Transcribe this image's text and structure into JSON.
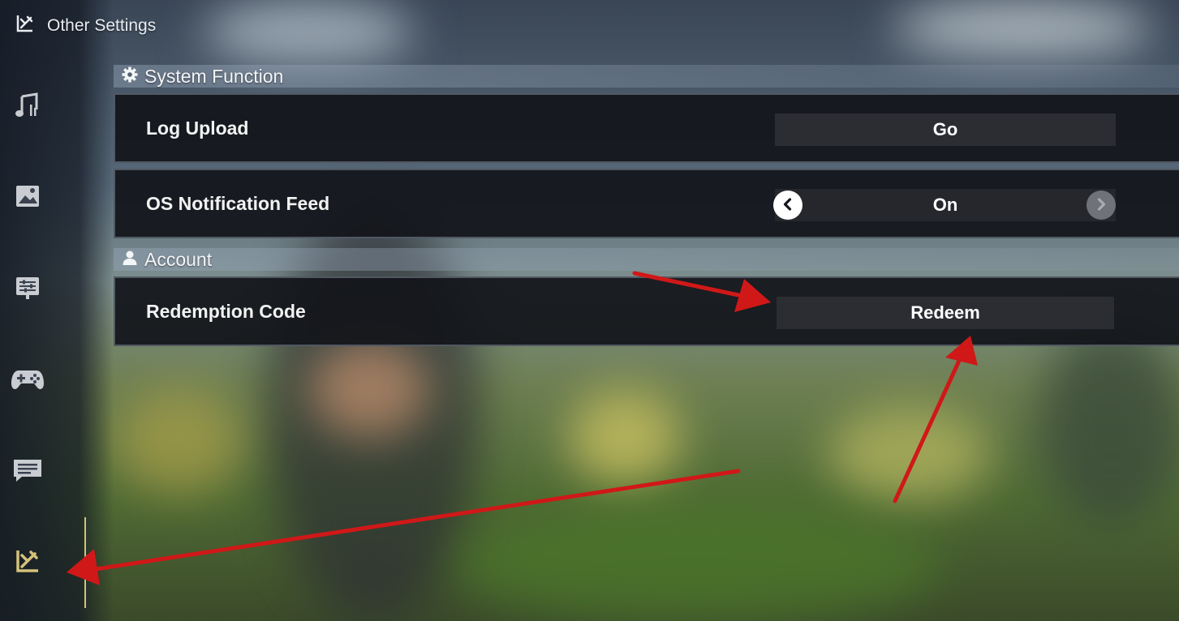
{
  "header": {
    "title": "Other Settings",
    "icon": "wrench-brush-icon"
  },
  "sidebar": {
    "items": [
      {
        "name": "sidebar-item-audio",
        "icon": "music-note-icon"
      },
      {
        "name": "sidebar-item-graphics",
        "icon": "image-icon"
      },
      {
        "name": "sidebar-item-display",
        "icon": "sliders-icon"
      },
      {
        "name": "sidebar-item-controls",
        "icon": "gamepad-icon"
      },
      {
        "name": "sidebar-item-chat",
        "icon": "chat-icon"
      },
      {
        "name": "sidebar-item-other",
        "icon": "wrench-brush-icon",
        "active": true
      }
    ],
    "active_color": "#d4c27a"
  },
  "sections": {
    "system": {
      "title": "System Function",
      "icon": "gear-icon",
      "log_upload": {
        "label": "Log Upload",
        "button": "Go"
      },
      "notification": {
        "label": "OS Notification Feed",
        "value": "On"
      }
    },
    "account": {
      "title": "Account",
      "icon": "person-icon",
      "redemption": {
        "label": "Redemption Code",
        "button": "Redeem"
      }
    }
  },
  "annotations": {
    "arrow_color": "#d01818",
    "count": 3
  }
}
